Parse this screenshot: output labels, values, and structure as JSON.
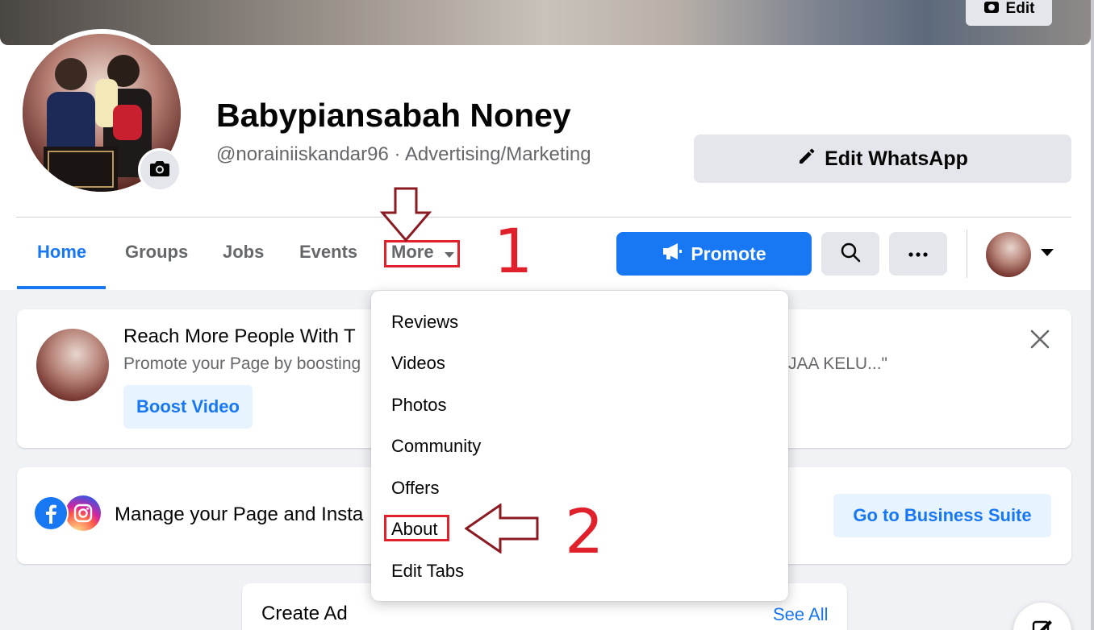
{
  "cover": {
    "edit_label": "Edit"
  },
  "profile": {
    "name": "Babypiansabah Noney",
    "subtitle": "@norainiiskandar96 · Advertising/Marketing",
    "edit_whatsapp_label": "Edit WhatsApp"
  },
  "tabs": [
    {
      "label": "Home",
      "active": true
    },
    {
      "label": "Groups"
    },
    {
      "label": "Jobs"
    },
    {
      "label": "Events"
    },
    {
      "label": "More"
    }
  ],
  "actions": {
    "promote_label": "Promote"
  },
  "boost_card": {
    "title": "Reach More People With T",
    "subtitle": "Promote your Page by boosting",
    "subtitle_tail": "N JAA KELU...\"",
    "button_label": "Boost Video"
  },
  "manage_card": {
    "text": "Manage your Page and Insta",
    "button_label": "Go to Business Suite"
  },
  "create_ad": {
    "title": "Create Ad",
    "see_all": "See All"
  },
  "more_menu": {
    "items": [
      "Reviews",
      "Videos",
      "Photos",
      "Community",
      "Offers",
      "About",
      "Edit Tabs"
    ]
  },
  "annotations": {
    "step1": "1",
    "step2": "2",
    "color": "#e0202b",
    "arrow_color": "#8b1a22"
  },
  "colors": {
    "accent": "#1877f2",
    "secondary_button": "#e4e6eb",
    "light_blue_button": "#e7f3ff"
  }
}
